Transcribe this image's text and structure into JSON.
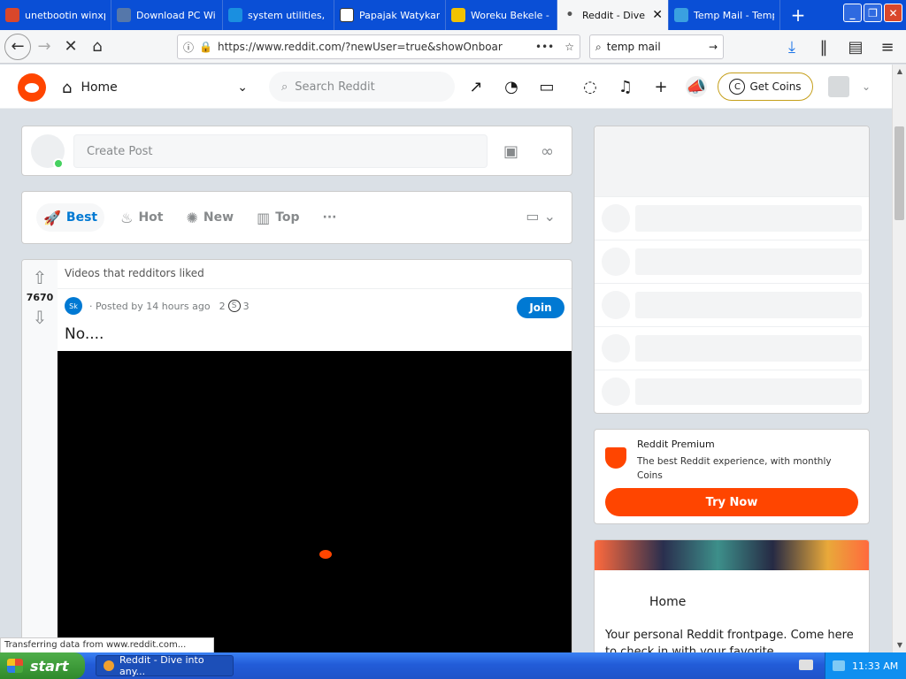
{
  "browser": {
    "tabs": [
      {
        "label": "unetbootin winxp",
        "fav_color": "#d9472b",
        "active": false
      },
      {
        "label": "Download PC Wi",
        "fav_color": "#5577aa",
        "active": false
      },
      {
        "label": "system utilities, a",
        "fav_color": "#1a8fe0",
        "active": false
      },
      {
        "label": "Papajak Watykan",
        "fav_color": "#ffffff",
        "active": false
      },
      {
        "label": "Woreku Bekele - Y",
        "fav_color": "#f2c200",
        "active": false
      },
      {
        "label": "Reddit - Dive i",
        "fav_color": "#888888",
        "active": true
      },
      {
        "label": "Temp Mail - Temp",
        "fav_color": "#3aa0e0",
        "active": false
      }
    ],
    "new_tab_glyph": "+",
    "url": "https://www.reddit.com/?newUser=true&showOnboar",
    "search_value": "temp mail",
    "status_text": "Transferring data from www.reddit.com..."
  },
  "reddit": {
    "home_label": "Home",
    "search_placeholder": "Search Reddit",
    "get_coins_label": "Get Coins",
    "create_post_placeholder": "Create Post",
    "sort": [
      {
        "label": "Best",
        "icon": "rocket-icon",
        "active": true
      },
      {
        "label": "Hot",
        "icon": "flame-icon",
        "active": false
      },
      {
        "label": "New",
        "icon": "sparkle-icon",
        "active": false
      },
      {
        "label": "Top",
        "icon": "chart-icon",
        "active": false
      }
    ],
    "post": {
      "header": "Videos that redditors liked",
      "votes": "7670",
      "subreddit_avatar": "Sk",
      "meta": "· Posted by 14 hours ago",
      "award_count_1": "2",
      "award_count_2": "3",
      "join_label": "Join",
      "title": "No...."
    },
    "premium": {
      "title": "Reddit Premium",
      "description": "The best Reddit experience, with monthly Coins",
      "button_label": "Try Now"
    },
    "home_card": {
      "title": "Home",
      "description": "Your personal Reddit frontpage. Come here to check in with your favorite"
    }
  },
  "taskbar": {
    "start_label": "start",
    "task_label": "Reddit - Dive into any...",
    "clock": "11:33 AM"
  },
  "colors": {
    "reddit_orange": "#ff4500",
    "reddit_blue": "#0079d3",
    "xp_blue": "#225cd8"
  }
}
